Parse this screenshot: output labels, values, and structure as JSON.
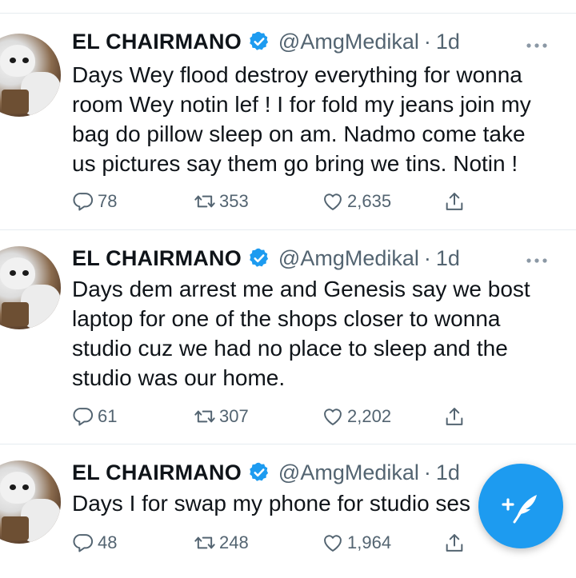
{
  "tweets": [
    {
      "name": "EL CHAIRMANO",
      "handle": "@AmgMedikal",
      "separator": "·",
      "time": "1d",
      "lines": [
        "Days Wey flood destroy everything for wonna",
        "room Wey notin lef ! I for fold my jeans join my",
        "bag do pillow sleep on am. Nadmo come take",
        "us pictures say them go bring we tins. Notin !"
      ],
      "replies": "78",
      "retweets": "353",
      "likes": "2,635"
    },
    {
      "name": "EL CHAIRMANO",
      "handle": "@AmgMedikal",
      "separator": "·",
      "time": "1d",
      "lines": [
        "Days dem arrest me and Genesis say we bost",
        "laptop for one of the shops closer to wonna",
        "studio cuz we had no place to sleep and the",
        "studio was our home."
      ],
      "replies": "61",
      "retweets": "307",
      "likes": "2,202"
    },
    {
      "name": "EL CHAIRMANO",
      "handle": "@AmgMedikal",
      "separator": "·",
      "time": "1d",
      "lines": [
        "Days I for swap my phone for studio ses"
      ],
      "replies": "48",
      "retweets": "248",
      "likes": "1,964"
    }
  ],
  "icons": {
    "verified": "verified-badge-icon",
    "more": "more-options-icon",
    "reply": "reply-icon",
    "retweet": "retweet-icon",
    "like": "like-icon",
    "share": "share-icon",
    "compose": "compose-tweet-icon"
  },
  "colors": {
    "accent": "#1d9bf0",
    "text": "#0f1419",
    "secondary": "#536471",
    "divider": "#e6ecf0"
  }
}
